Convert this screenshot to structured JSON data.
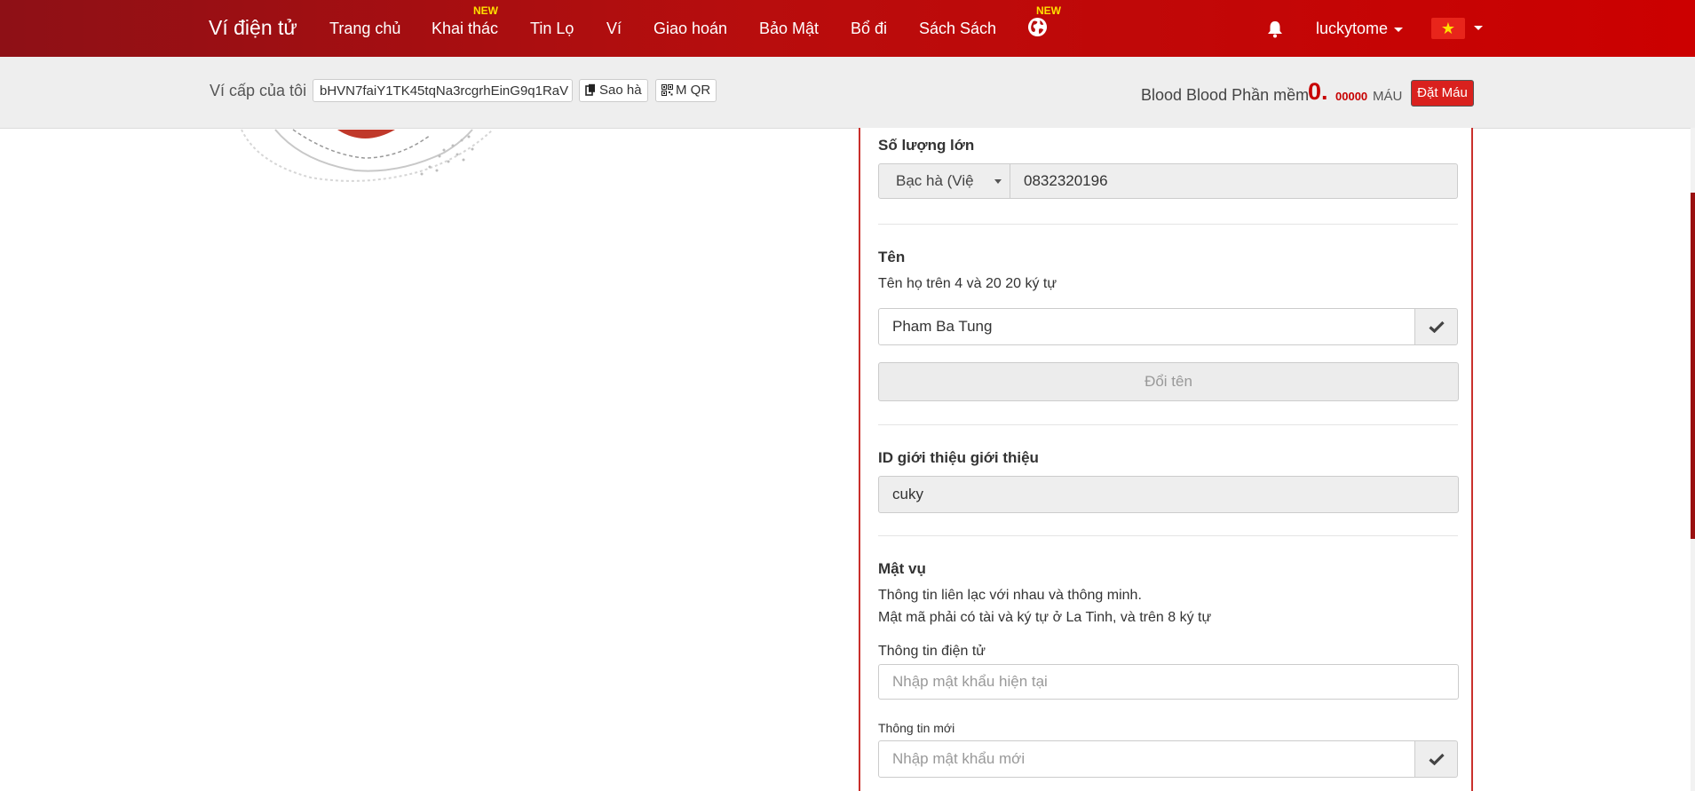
{
  "navbar": {
    "brand": "Ví điện tử",
    "items": [
      {
        "label": "Trang chủ",
        "badge": ""
      },
      {
        "label": "Khai thác",
        "badge": "NEW"
      },
      {
        "label": "Tin Lọ",
        "badge": ""
      },
      {
        "label": "Ví",
        "badge": ""
      },
      {
        "label": "Giao hoán",
        "badge": ""
      },
      {
        "label": "Bảo Mật",
        "badge": ""
      },
      {
        "label": "Bổ đi",
        "badge": ""
      },
      {
        "label": "Sách Sách",
        "badge": ""
      }
    ],
    "globe_badge": "NEW",
    "globe_icon": "globe-icon",
    "bell_icon": "bell-icon",
    "username": "luckytome",
    "flag_symbol": "★",
    "colors": {
      "bar": "#b80d0d",
      "badge": "#ffe000"
    }
  },
  "wallet": {
    "label": "Ví cấp của tôi",
    "address": "bHVN7faiY1TK45tqNa3rcgrhEinG9q1RaV",
    "copy_label": "Sao hà",
    "qr_label": "M QR",
    "balance_label": "Blood Blood Phần mềm",
    "balance_int": "0.",
    "balance_dec": "00000",
    "unit": "MÁU",
    "deposit_label": "Đặt Máu"
  },
  "form": {
    "phone": {
      "title": "Số lượng lớn",
      "country": "Bạc hà (Việ",
      "number": "0832320196"
    },
    "name": {
      "title": "Tên",
      "desc": "Tên họ trên 4 và 20 20 ký tự",
      "value": "Pham Ba Tung",
      "button": "Đổi tên"
    },
    "referral": {
      "title": "ID giới thiệu giới thiệu",
      "value": "cuky"
    },
    "password": {
      "title": "Mật vụ",
      "desc1": "Thông tin liên lạc với nhau và thông minh.",
      "desc2": "Mật mã phải có tài và ký tự ở La Tinh, và trên 8 ký tự",
      "current_label": "Thông tin điện tử",
      "current_placeholder": "Nhập mật khẩu hiện tại",
      "new_label": "Thông tin mới",
      "new_placeholder": "Nhập mật khẩu mới"
    },
    "accent": "#c9302c"
  }
}
